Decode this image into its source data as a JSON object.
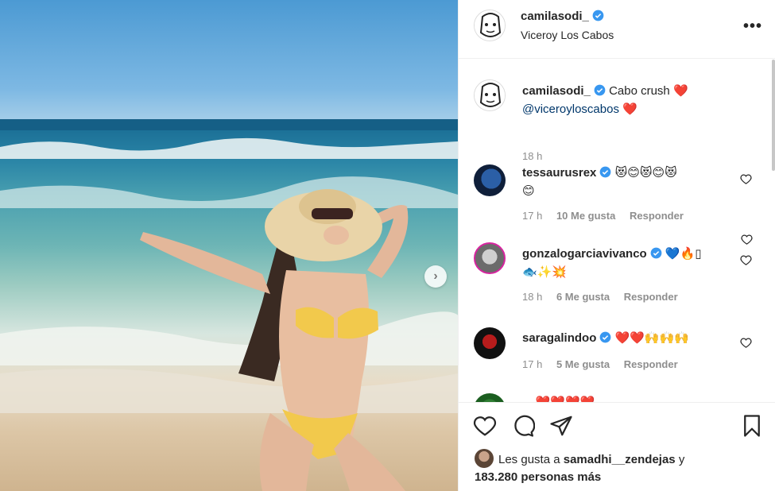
{
  "post": {
    "photo": {
      "next_icon": "chevron-right-icon"
    },
    "header": {
      "username": "camilasodi_",
      "location": "Viceroy Los Cabos",
      "more_icon": "more-horizontal-icon",
      "more_label": "•••"
    },
    "caption": {
      "username": "camilasodi_",
      "text": "Cabo crush",
      "emoji1": "❤️",
      "mention": "@viceroyloscabos",
      "emoji2": "❤️",
      "time": "18 h"
    },
    "comments": [
      {
        "username": "tessaurusrex",
        "text": "😻😊😻😊😻",
        "text2": "😊",
        "time": "17 h",
        "likes": "10 Me gusta",
        "reply": "Responder"
      },
      {
        "username": "gonzalogarciavivanco",
        "text": "💙🔥▯",
        "text2": "🐟✨💥",
        "time": "18 h",
        "likes": "6 Me gusta",
        "reply": "Responder"
      },
      {
        "username": "saragalindoo",
        "text": "❤️❤️🙌🙌🙌",
        "time": "17 h",
        "likes": "5 Me gusta",
        "reply": "Responder"
      },
      {
        "username": "...",
        "text": "❤️❤️❤️❤️"
      }
    ],
    "actions": {
      "like_icon": "heart-icon",
      "comment_icon": "comment-icon",
      "share_icon": "send-icon",
      "save_icon": "bookmark-icon"
    },
    "likes_line": {
      "prefix": "Les gusta a",
      "user": "samadhi__zendejas",
      "conj": "y",
      "count": "183.280 personas más"
    },
    "colors": {
      "verified": "#3897f0",
      "mention": "#00376b",
      "muted": "#8e8e8e",
      "heart_red": "#ed4956"
    }
  }
}
